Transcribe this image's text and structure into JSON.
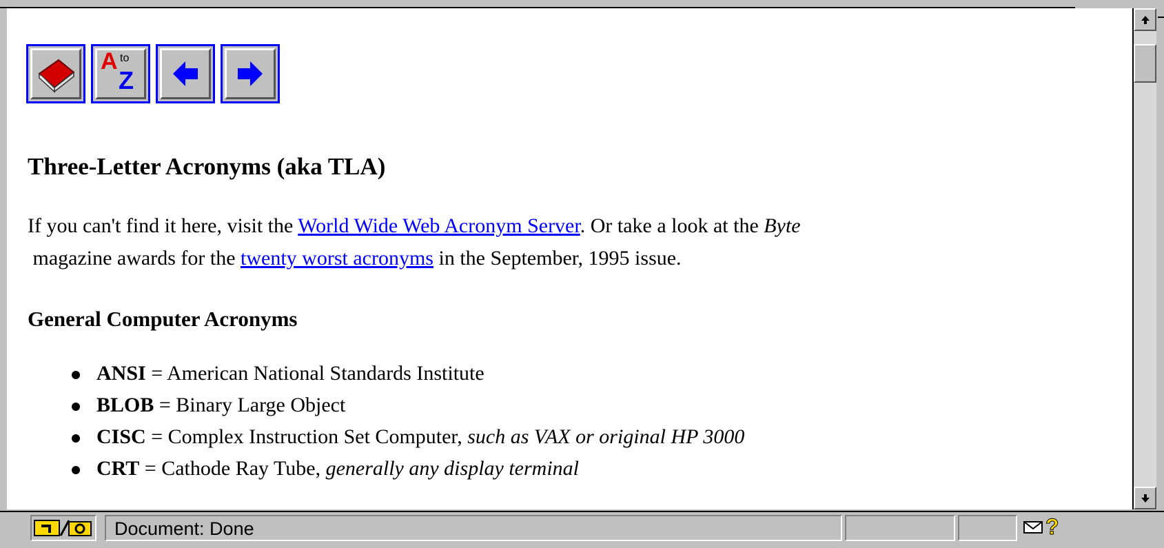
{
  "toolbar": {
    "buttons": [
      {
        "name": "book-icon"
      },
      {
        "name": "a-to-z-icon",
        "letter_top": "A",
        "letter_to": "to",
        "letter_bottom": "Z"
      },
      {
        "name": "back-arrow-icon"
      },
      {
        "name": "forward-arrow-icon"
      }
    ],
    "border_color": "#0000ff"
  },
  "page": {
    "title": "Three-Letter Acronyms (aka TLA)",
    "intro_1": "If you can't find it here, visit the ",
    "link_acronym_server": "World Wide Web Acronym Server",
    "intro_2": ". Or take a look at the ",
    "intro_byte": "Byte",
    "intro_3": " magazine awards for the ",
    "link_worst": "twenty worst acronyms",
    "intro_4": " in the September, 1995 issue.",
    "section_heading": "General Computer Acronyms",
    "acronyms": [
      {
        "term": "ANSI",
        "eq": " = ",
        "definition": "American National Standards Institute",
        "note": ""
      },
      {
        "term": "BLOB",
        "eq": " = ",
        "definition": "Binary Large Object",
        "note": ""
      },
      {
        "term": "CISC",
        "eq": " = ",
        "definition": "Complex Instruction Set Computer, ",
        "note": "such as VAX or original HP 3000"
      },
      {
        "term": "CRT",
        "eq": " = ",
        "definition": "Cathode Ray Tube, ",
        "note": "generally any display terminal"
      }
    ],
    "link_color": "#0000ff"
  },
  "statusbar": {
    "text": "Document: Done",
    "security_icon": "key-lock-icon",
    "mail_icon": "mail-icon",
    "help_icon": "question-icon"
  }
}
